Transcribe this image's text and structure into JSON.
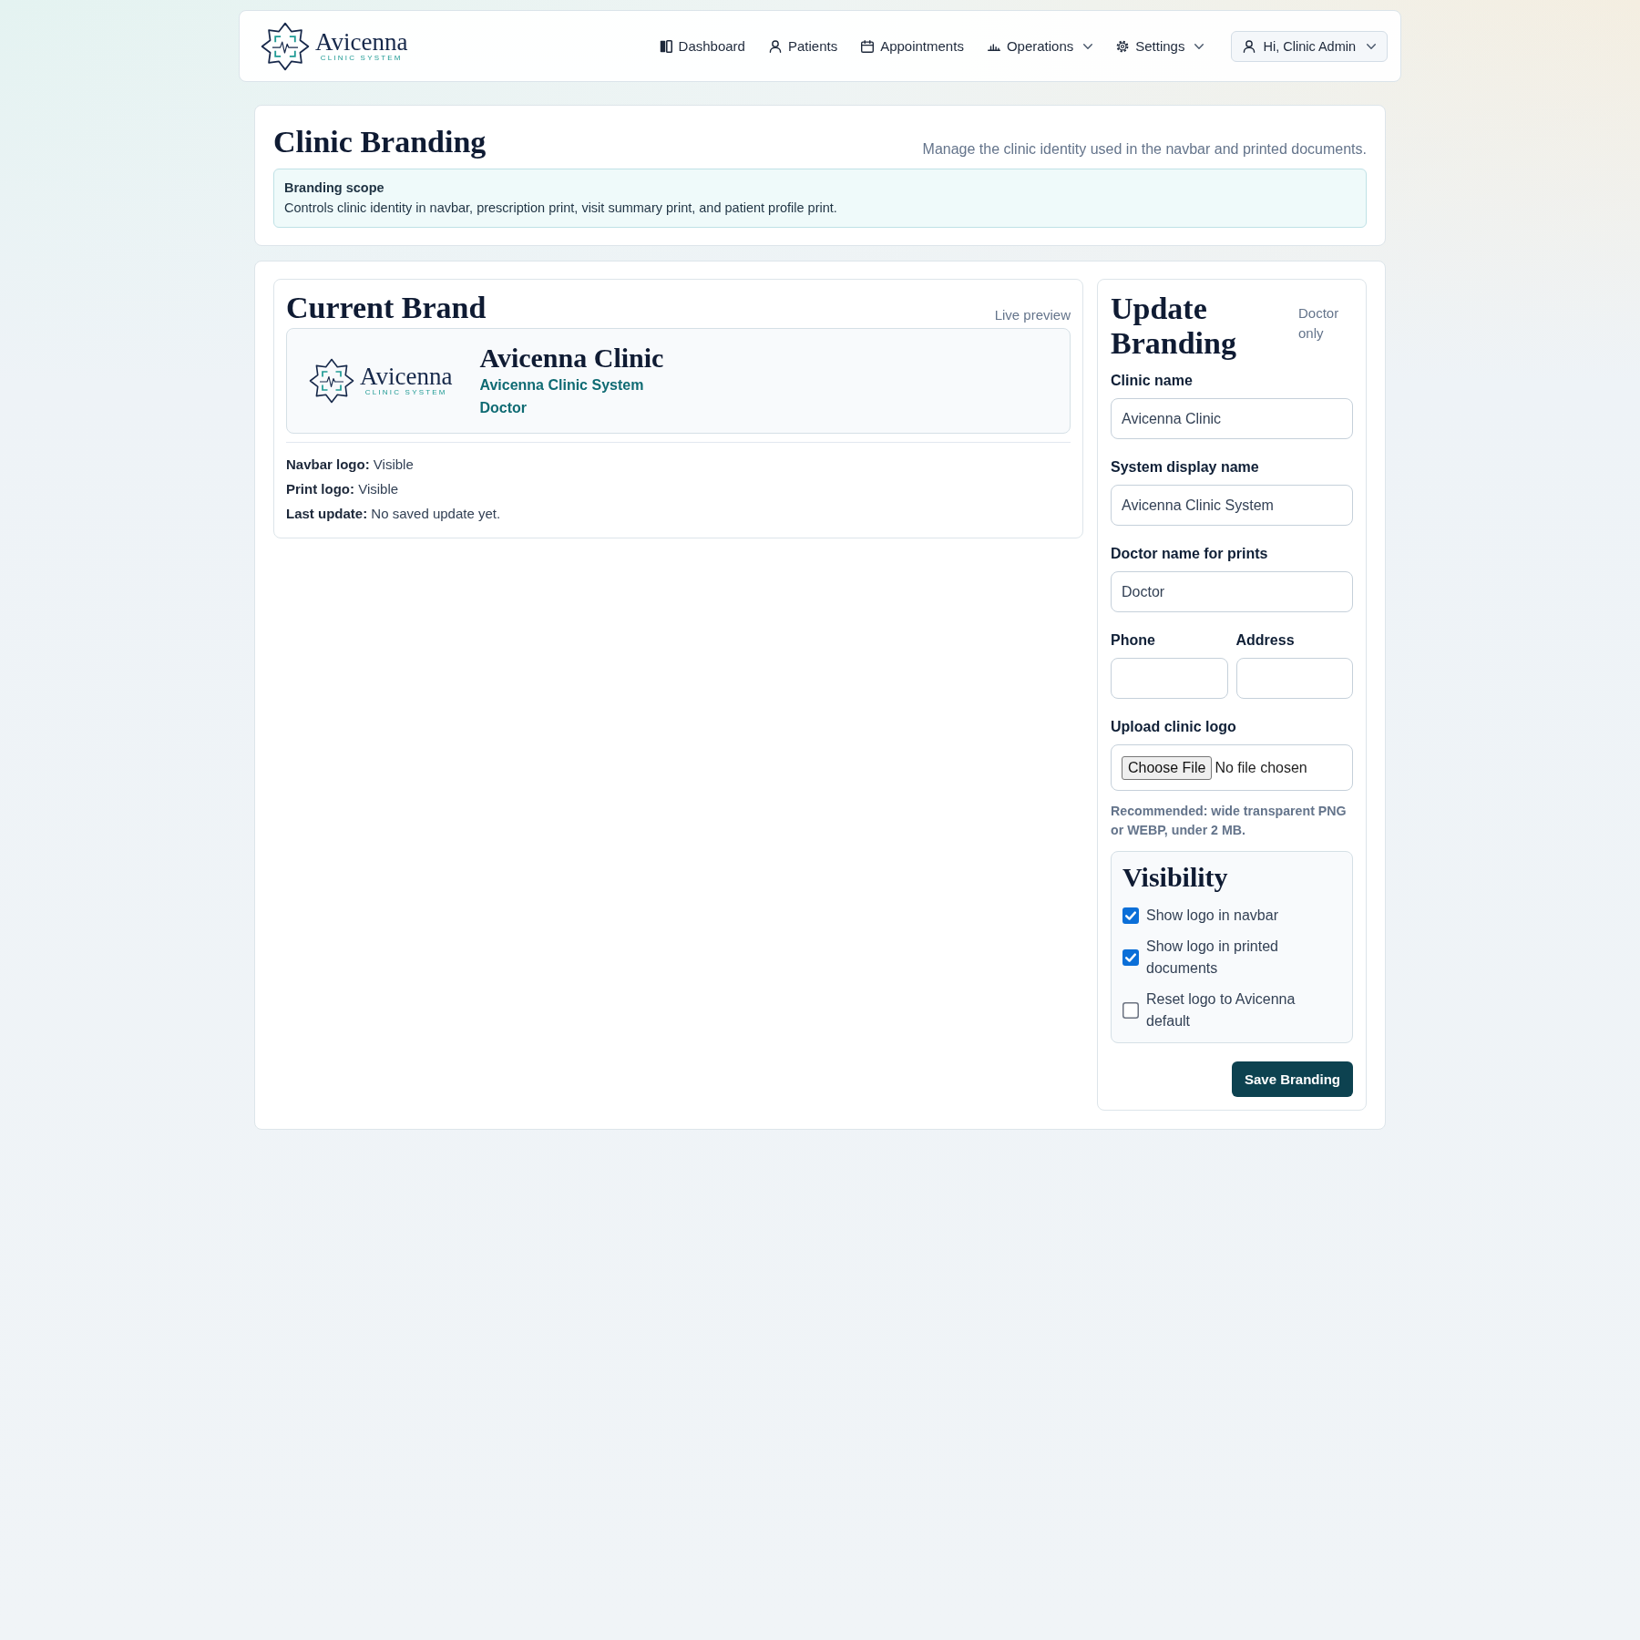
{
  "navbar": {
    "logo": {
      "name": "Avicenna",
      "tagline": "CLINIC SYSTEM"
    },
    "links": [
      {
        "label": "Dashboard",
        "has_menu": false
      },
      {
        "label": "Patients",
        "has_menu": false
      },
      {
        "label": "Appointments",
        "has_menu": false
      },
      {
        "label": "Operations",
        "has_menu": true
      },
      {
        "label": "Settings",
        "has_menu": true
      }
    ],
    "user_menu": {
      "label": "Hi, Clinic Admin",
      "has_menu": true
    }
  },
  "header": {
    "title": "Clinic Branding",
    "subtitle": "Manage the clinic identity used in the navbar and printed documents.",
    "scope": {
      "title": "Branding scope",
      "text": "Controls clinic identity in navbar, prescription print, visit summary print, and patient profile print."
    }
  },
  "current_brand": {
    "title": "Current Brand",
    "note": "Live preview",
    "preview": {
      "logo": {
        "name": "Avicenna",
        "tagline": "CLINIC SYSTEM"
      },
      "clinic_name": "Avicenna Clinic",
      "system_name": "Avicenna Clinic System",
      "doctor": "Doctor"
    },
    "details": [
      "**Navbar logo:** Visible",
      "**Print logo:** Visible",
      "**Last update:** No saved update yet."
    ]
  },
  "update_form": {
    "title": "Update Branding",
    "note": "Doctor only",
    "fields": [
      {
        "label": "Clinic name",
        "value": "Avicenna Clinic"
      },
      {
        "label": "System display name",
        "value": "Avicenna Clinic System"
      },
      {
        "label": "Doctor name for prints",
        "value": "Doctor"
      }
    ],
    "contact_fields": [
      {
        "label": "Phone"
      },
      {
        "label": "Address"
      }
    ],
    "upload": {
      "label": "Upload clinic logo",
      "button": "Choose File",
      "status": "No file chosen"
    },
    "hint": "Recommended: wide transparent PNG or WEBP, under 2 MB.",
    "visibility": {
      "title": "Visibility",
      "options": [
        {
          "label": "Show logo in navbar",
          "checked": true
        },
        {
          "label": "Show logo in printed documents",
          "checked": true
        },
        {
          "label": "Reset logo to Avicenna default",
          "checked": false
        }
      ]
    },
    "submit": "Save Branding"
  }
}
